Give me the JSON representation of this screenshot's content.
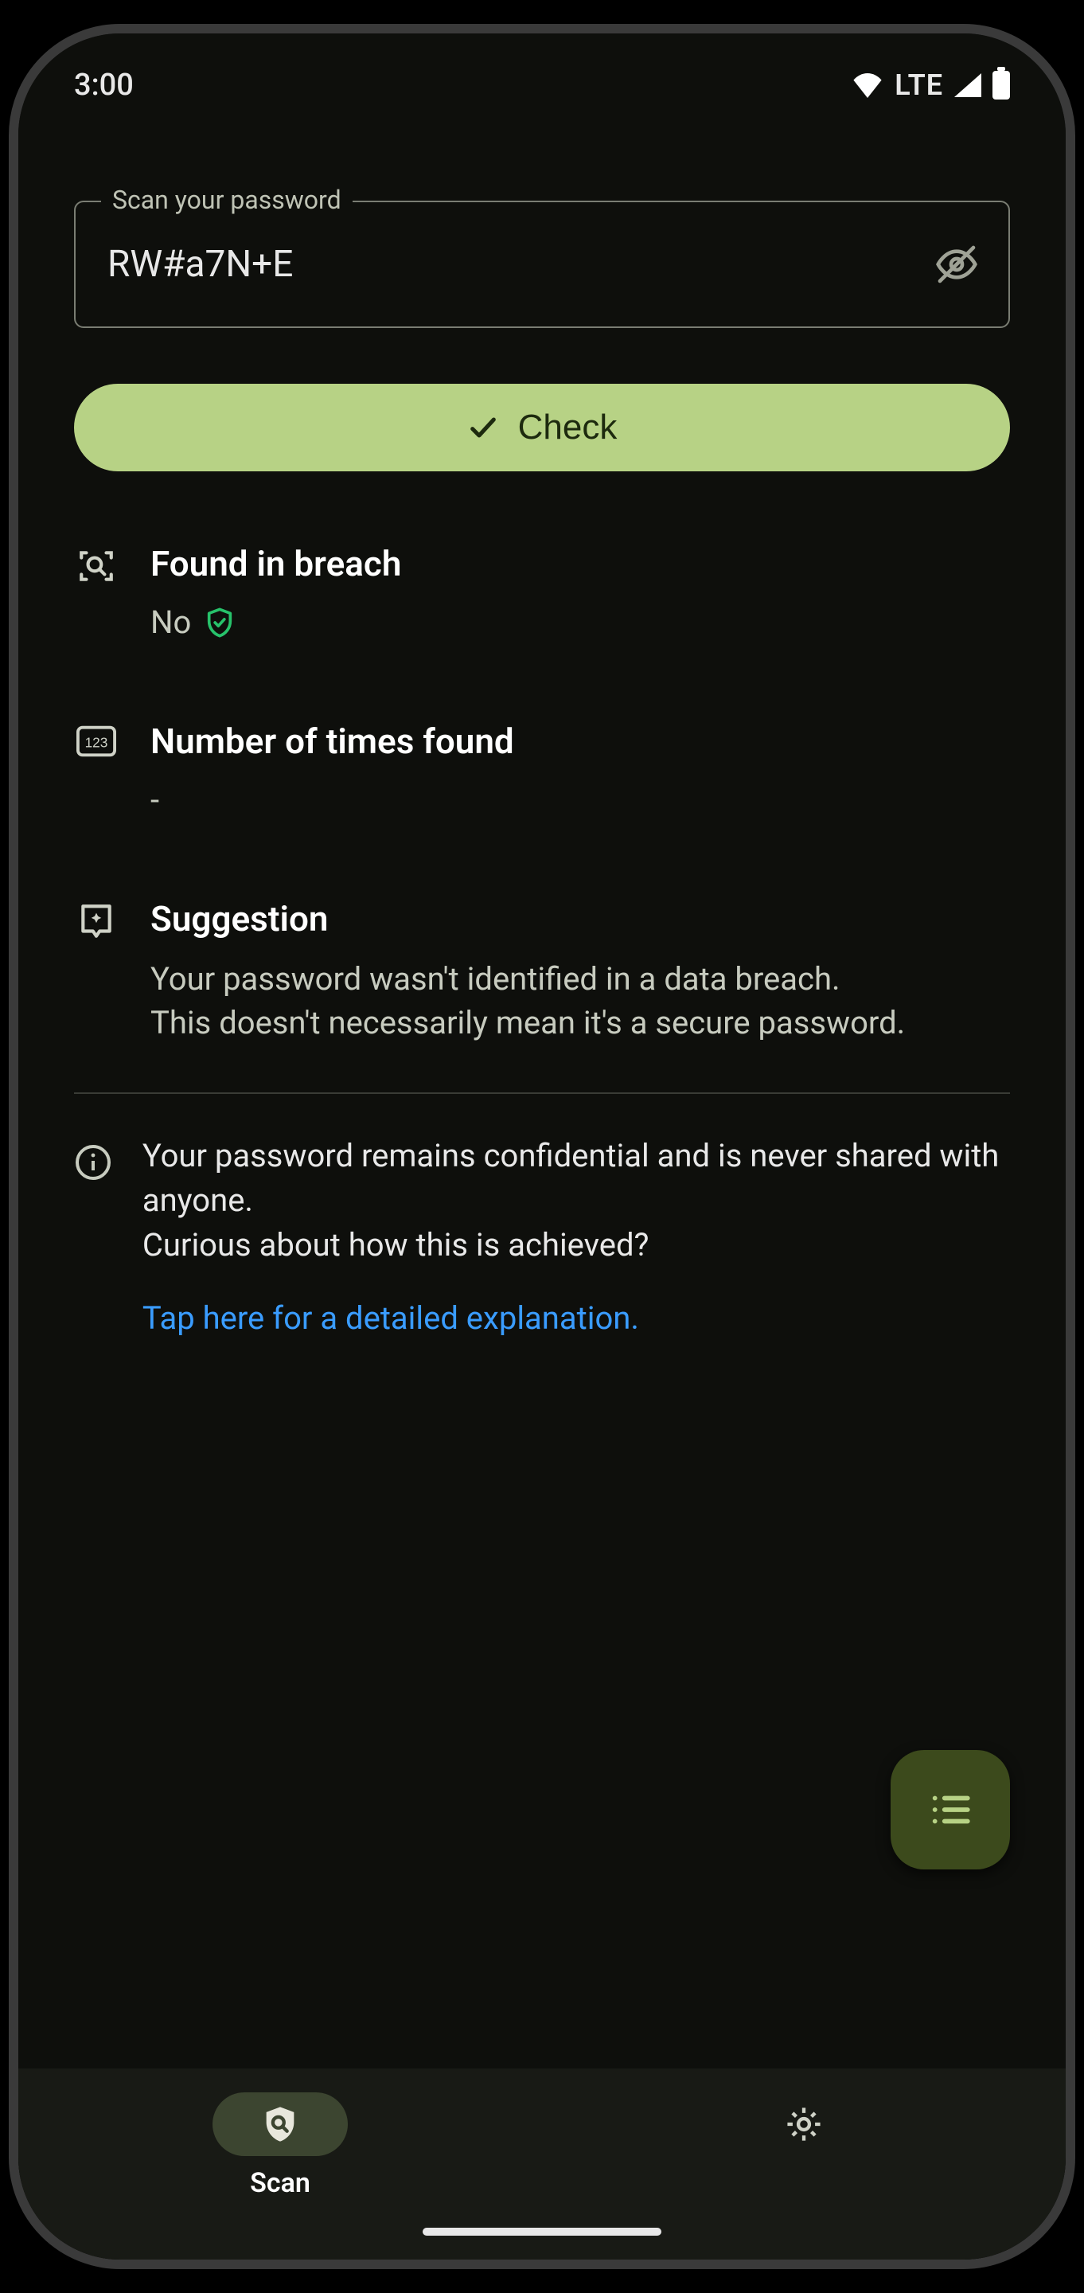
{
  "status_bar": {
    "time": "3:00",
    "network_label": "LTE"
  },
  "field": {
    "label": "Scan your password",
    "value": "RW#a7N+E"
  },
  "buttons": {
    "check": "Check"
  },
  "results": {
    "breach": {
      "title": "Found in breach",
      "value": "No"
    },
    "count": {
      "title": "Number of times found",
      "value": "-"
    },
    "suggestion": {
      "title": "Suggestion",
      "line1": "Your password wasn't identified in a data breach.",
      "line2": "This doesn't necessarily mean it's a secure password."
    }
  },
  "info": {
    "line1": "Your password remains confidential and is never shared with anyone.",
    "line2": "Curious about how this is achieved?",
    "link": "Tap here for a detailed explanation."
  },
  "nav": {
    "scan": "Scan"
  }
}
